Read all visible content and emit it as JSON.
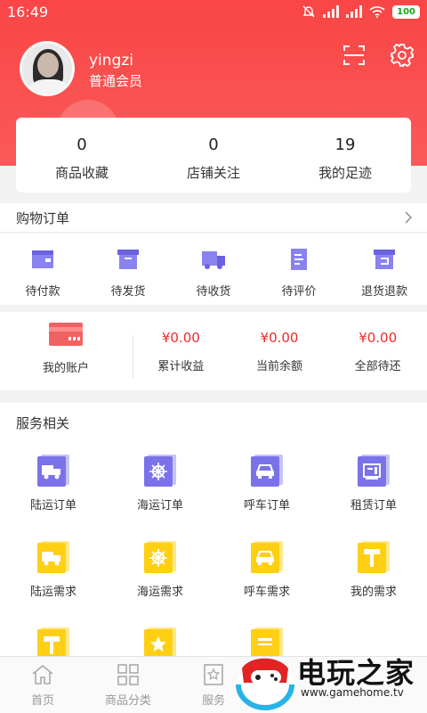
{
  "status_bar": {
    "time": "16:49",
    "battery": "100"
  },
  "profile": {
    "username": "yingzi",
    "level": "普通会员"
  },
  "stats": [
    {
      "value": "0",
      "label": "商品收藏"
    },
    {
      "value": "0",
      "label": "店铺关注"
    },
    {
      "value": "19",
      "label": "我的足迹"
    }
  ],
  "orders": {
    "title": "购物订单",
    "items": [
      {
        "label": "待付款",
        "icon": "wallet-icon"
      },
      {
        "label": "待发货",
        "icon": "box-icon"
      },
      {
        "label": "待收货",
        "icon": "truck-icon"
      },
      {
        "label": "待评价",
        "icon": "document-icon"
      },
      {
        "label": "退货退款",
        "icon": "return-box-icon"
      }
    ]
  },
  "account": {
    "label": "我的账户",
    "values": [
      {
        "amount": "¥0.00",
        "label": "累计收益"
      },
      {
        "amount": "¥0.00",
        "label": "当前余额"
      },
      {
        "amount": "¥0.00",
        "label": "全部待还"
      }
    ]
  },
  "services": {
    "title": "服务相关",
    "items": [
      {
        "label": "陆运订单",
        "icon": "truck-icon",
        "color": "purple"
      },
      {
        "label": "海运订单",
        "icon": "ship-wheel-icon",
        "color": "purple"
      },
      {
        "label": "呼车订单",
        "icon": "car-icon",
        "color": "purple"
      },
      {
        "label": "租赁订单",
        "icon": "rental-icon",
        "color": "purple"
      },
      {
        "label": "陆运需求",
        "icon": "truck-icon",
        "color": "yellow"
      },
      {
        "label": "海运需求",
        "icon": "ship-wheel-icon",
        "color": "yellow"
      },
      {
        "label": "呼车需求",
        "icon": "car-icon",
        "color": "yellow"
      },
      {
        "label": "我的需求",
        "icon": "pin-icon",
        "color": "yellow"
      }
    ]
  },
  "tabbar": [
    {
      "label": "首页",
      "icon": "home-icon"
    },
    {
      "label": "商品分类",
      "icon": "grid-icon"
    },
    {
      "label": "服务",
      "icon": "star-badge-icon"
    }
  ],
  "watermark": {
    "brand": "电玩之家",
    "url": "www.gamehome.tv"
  },
  "colors": {
    "header_red": "#f94545",
    "amount_red": "#ee2b2b",
    "purple": "#7b72e9",
    "yellow": "#ffcf14"
  }
}
